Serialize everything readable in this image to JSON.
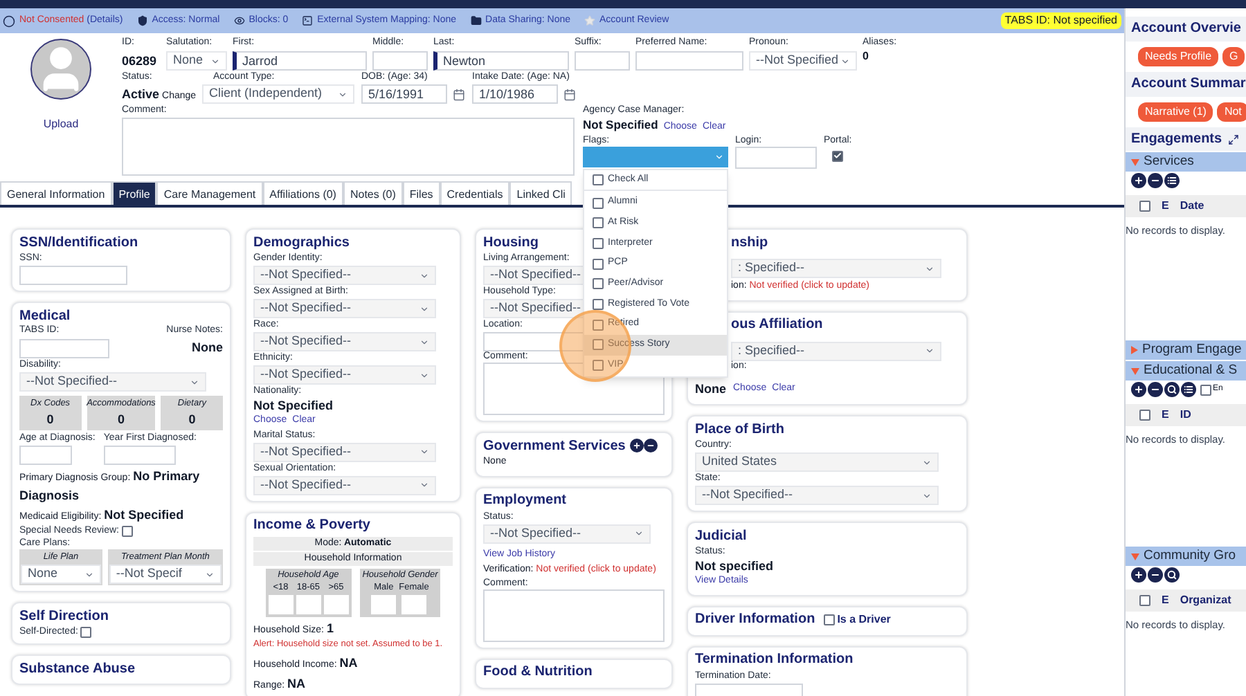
{
  "info_bar": {
    "items": [
      {
        "kind": "consent",
        "text": "Not Consented",
        "link": "(Details)"
      },
      {
        "kind": "shield",
        "text": "Access: Normal"
      },
      {
        "kind": "eye",
        "text": "Blocks: 0"
      },
      {
        "kind": "terminal",
        "text": "External System Mapping: None"
      },
      {
        "kind": "folder",
        "text": "Data Sharing: None"
      },
      {
        "kind": "star",
        "text": "Account Review"
      }
    ],
    "tabs_id": "TABS ID: Not specified"
  },
  "header": {
    "upload": "Upload",
    "id": {
      "label": "ID:",
      "value": "06289"
    },
    "salutation": {
      "label": "Salutation:",
      "value": "None"
    },
    "first": {
      "label": "First:",
      "value": "Jarrod"
    },
    "middle": {
      "label": "Middle:"
    },
    "last": {
      "label": "Last:",
      "value": "Newton"
    },
    "suffix": {
      "label": "Suffix:"
    },
    "preferred_name": {
      "label": "Preferred Name:"
    },
    "pronoun": {
      "label": "Pronoun:",
      "value": "--Not Specified"
    },
    "aliases": {
      "label": "Aliases:",
      "value": "0"
    },
    "status": {
      "label": "Status:",
      "value": "Active",
      "action": "Change"
    },
    "account_type": {
      "label": "Account Type:",
      "value": "Client (Independent)"
    },
    "dob": {
      "label": "DOB: (Age: 34)",
      "value": "5/16/1991"
    },
    "intake_date": {
      "label": "Intake Date: (Age: NA)",
      "value": "1/10/1986"
    },
    "comment": {
      "label": "Comment:"
    },
    "case_manager": {
      "label": "Agency Case Manager:",
      "value": "Not Specified",
      "choose": "Choose",
      "clear": "Clear"
    },
    "flags": {
      "label": "Flags:",
      "expanded": true,
      "options": [
        {
          "label": "Check All",
          "checked": false,
          "selected": false
        },
        {
          "label": "Alumni",
          "checked": false,
          "selected": false
        },
        {
          "label": "At Risk",
          "checked": false,
          "selected": false
        },
        {
          "label": "Interpreter",
          "checked": false,
          "selected": false
        },
        {
          "label": "PCP",
          "checked": false,
          "selected": false
        },
        {
          "label": "Peer/Advisor",
          "checked": false,
          "selected": false
        },
        {
          "label": "Registered To Vote",
          "checked": false,
          "selected": false
        },
        {
          "label": "Retired",
          "checked": false,
          "selected": false
        },
        {
          "label": "Success Story",
          "checked": false,
          "selected": true
        },
        {
          "label": "VIP",
          "checked": false,
          "selected": false
        }
      ]
    },
    "login": {
      "label": "Login:"
    },
    "portal": {
      "label": "Portal:",
      "checked": true
    }
  },
  "tabs": [
    {
      "label": "General Information",
      "selected": false
    },
    {
      "label": "Profile",
      "selected": true
    },
    {
      "label": "Care Management",
      "selected": false
    },
    {
      "label": "Affiliations (0)",
      "selected": false
    },
    {
      "label": "Notes (0)",
      "selected": false
    },
    {
      "label": "Files",
      "selected": false
    },
    {
      "label": "Credentials",
      "selected": false
    },
    {
      "label": "Linked Cli",
      "selected": false
    }
  ],
  "columns": [
    [
      {
        "title": "SSN/Identification",
        "fields": [
          {
            "kind": "input",
            "label": "SSN:"
          }
        ]
      },
      {
        "title": "Medical",
        "fields": [
          {
            "kind": "id_notes",
            "label": "TABS ID:",
            "notes_label": "Nurse Notes:",
            "notes_value": "None"
          },
          {
            "kind": "select",
            "label": "Disability:",
            "value": "--Not Specified--"
          },
          {
            "kind": "counts",
            "items": [
              {
                "label": "Dx Codes",
                "value": "0"
              },
              {
                "label": "Accommodations",
                "value": "0"
              },
              {
                "label": "Dietary",
                "value": "0"
              }
            ]
          },
          {
            "kind": "inputs",
            "items": [
              "Age at Diagnosis:",
              "Year First Diagnosed:"
            ]
          },
          {
            "kind": "inline",
            "label": "Primary Diagnosis Group:",
            "value": "No Primary Diagnosis"
          },
          {
            "kind": "inline",
            "label": "Medicaid Eligibility:",
            "value": "Not Specified"
          },
          {
            "kind": "checkbox",
            "label": "Special Needs Review:",
            "checked": false
          },
          {
            "kind": "plans",
            "label": "Care Plans:",
            "items": [
              {
                "heading": "Life Plan",
                "value": "None"
              },
              {
                "heading": "Treatment Plan Month",
                "value": "--Not Specif"
              }
            ]
          }
        ]
      },
      {
        "title": "Self Direction",
        "fields": [
          {
            "kind": "checkbox",
            "label": "Self-Directed:",
            "checked": false
          }
        ]
      },
      {
        "title": "Substance Abuse"
      }
    ],
    [
      {
        "title": "Demographics",
        "fields": [
          {
            "kind": "select",
            "label": "Gender Identity:",
            "value": "--Not Specified--"
          },
          {
            "kind": "select",
            "label": "Sex Assigned at Birth:",
            "value": "--Not Specified--"
          },
          {
            "kind": "select",
            "label": "Race:",
            "value": "--Not Specified--"
          },
          {
            "kind": "select",
            "label": "Ethnicity:",
            "value": "--Not Specified--"
          },
          {
            "kind": "choice_block",
            "label": "Nationality:",
            "value": "Not Specified",
            "links": [
              "Choose",
              "Clear"
            ]
          },
          {
            "kind": "select",
            "label": "Marital Status:",
            "value": "--Not Specified--"
          },
          {
            "kind": "select",
            "label": "Sexual Orientation:",
            "value": "--Not Specified--"
          }
        ]
      },
      {
        "title": "Income & Poverty",
        "fields": [
          {
            "kind": "bar",
            "label": "Mode:",
            "value": "Automatic"
          },
          {
            "kind": "bar",
            "label": "Household Information"
          },
          {
            "kind": "household",
            "groups": [
              {
                "heading": "Household Age",
                "cols": [
                  "<18",
                  "18-65",
                  ">65"
                ]
              },
              {
                "heading": "Household Gender",
                "cols": [
                  "Male",
                  "Female"
                ]
              }
            ]
          },
          {
            "kind": "inline",
            "label": "Household Size:",
            "value": "1"
          },
          {
            "kind": "alert",
            "text": "Alert: Household size not set. Assumed to be 1."
          },
          {
            "kind": "inline",
            "label": "Household Income:",
            "value": "NA"
          },
          {
            "kind": "inline",
            "label": "Range:",
            "value": "NA"
          }
        ]
      }
    ],
    [
      {
        "title": "Housing",
        "fields": [
          {
            "kind": "select",
            "label": "Living Arrangement:",
            "value": "--Not Specified--"
          },
          {
            "kind": "select",
            "label": "Household Type:",
            "value": "--Not Specified--"
          },
          {
            "kind": "input",
            "label": "Location:"
          },
          {
            "kind": "textarea",
            "label": "Comment:"
          }
        ]
      },
      {
        "title": "Government Services",
        "icons": [
          {
            "kind": "plus"
          },
          {
            "kind": "minus"
          }
        ],
        "fields": [
          {
            "kind": "text",
            "text": "None"
          }
        ]
      },
      {
        "title": "Employment",
        "fields": [
          {
            "kind": "select",
            "label": "Status:",
            "value": "--Not Specified--"
          },
          {
            "kind": "link",
            "text": "View Job History"
          },
          {
            "kind": "verification",
            "label": "Verification:",
            "value": "Not verified (click to update)"
          },
          {
            "kind": "textarea",
            "label": "Comment:"
          }
        ]
      },
      {
        "title": "Food & Nutrition"
      }
    ],
    [
      {
        "title": "nship",
        "fields": [
          {
            "kind": "select",
            "value": ": Specified--"
          },
          {
            "kind": "verification",
            "label": "ion:",
            "value": "Not verified (click to update)"
          }
        ]
      },
      {
        "title": "ous Affiliation",
        "fields": [
          {
            "kind": "select",
            "value": ": Specified--"
          },
          {
            "kind": "label",
            "label": "ion:"
          },
          {
            "kind": "choice_inline",
            "value": "None",
            "links": [
              "Choose",
              "Clear"
            ]
          }
        ]
      },
      {
        "title": "Place of Birth",
        "fields": [
          {
            "kind": "select",
            "label": "Country:",
            "value": "United States"
          },
          {
            "kind": "select",
            "label": "State:",
            "value": "--Not Specified--"
          }
        ]
      },
      {
        "title": "Judicial",
        "fields": [
          {
            "kind": "choice_block",
            "label": "Status:",
            "value": "Not specified",
            "links": [
              "View Details"
            ]
          }
        ]
      },
      {
        "title": "Driver Information",
        "check": {
          "label": "Is a Driver",
          "checked": false
        }
      },
      {
        "title": "Termination Information",
        "fields": [
          {
            "kind": "input",
            "label": "Termination Date:"
          }
        ]
      }
    ]
  ],
  "right_panel": {
    "overview": {
      "title": "Account Overvie",
      "buttons": [
        "Needs Profile",
        "G"
      ]
    },
    "summary": {
      "title": "Account Summar",
      "buttons": [
        "Narrative (1)",
        "Not"
      ]
    },
    "engagements": {
      "title": "Engagements",
      "sections": [
        {
          "title": "Services",
          "expanded": true,
          "tools": [
            {
              "kind": "plus"
            },
            {
              "kind": "minus"
            },
            {
              "kind": "list"
            }
          ],
          "header_checked": false,
          "columns": [
            "E",
            "Date"
          ],
          "empty": "No records to display."
        },
        {
          "title": "Program Engage",
          "expanded": false
        },
        {
          "title": "Educational & S",
          "expanded": true,
          "tools": [
            {
              "kind": "plus"
            },
            {
              "kind": "minus"
            },
            {
              "kind": "search"
            },
            {
              "kind": "list"
            }
          ],
          "filter": {
            "label": "En",
            "checked": false
          },
          "header_checked": false,
          "columns": [
            "E",
            "ID"
          ],
          "empty": "No records to display."
        },
        {
          "title": "Community Gro",
          "expanded": true,
          "tools": [
            {
              "kind": "plus"
            },
            {
              "kind": "minus"
            },
            {
              "kind": "search"
            }
          ],
          "header_checked": false,
          "columns": [
            "E",
            "Organizat"
          ],
          "empty": "No records to display."
        }
      ]
    }
  }
}
